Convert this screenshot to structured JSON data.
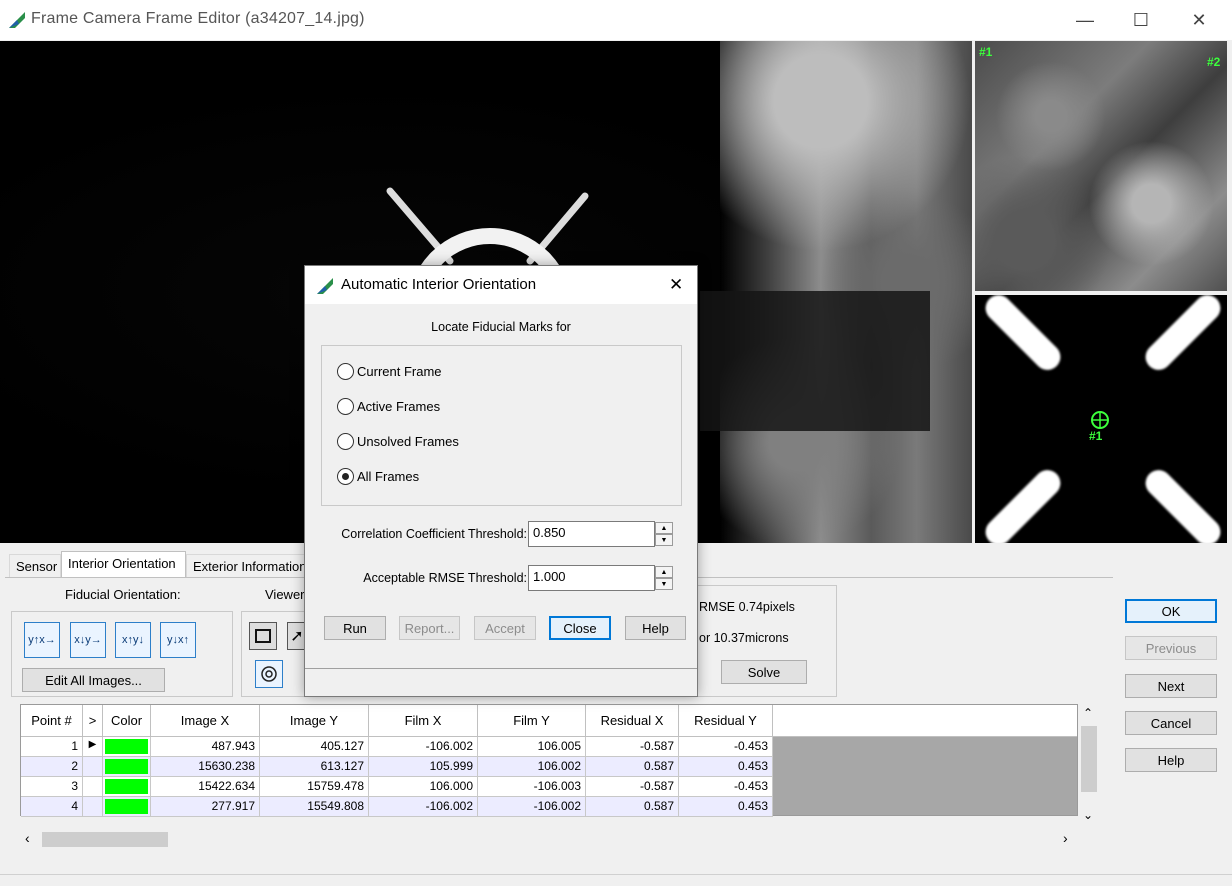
{
  "window": {
    "title": "Frame Camera Frame Editor (a34207_14.jpg)",
    "minimize_glyph": "—",
    "maximize_glyph": "☐",
    "close_glyph": "✕"
  },
  "viewers": {
    "overview_marks": [
      "#1",
      "#2"
    ],
    "zoom_mark": "#1"
  },
  "tabs": [
    "Sensor",
    "Interior Orientation",
    "Exterior Information"
  ],
  "interior": {
    "fiducial_orientation_label": "Fiducial Orientation:",
    "viewer_label": "Viewer",
    "orientation_buttons": [
      "y↑x→",
      "x↓y→",
      "x↑y↓",
      "y↓x↑"
    ],
    "edit_all_label": "Edit All Images...",
    "rmse_text": "RMSE 0.74pixels",
    "microns_text": "or 10.37microns",
    "solve_label": "Solve"
  },
  "table": {
    "columns": [
      "Point #",
      ">",
      "Color",
      "Image X",
      "Image Y",
      "Film X",
      "Film Y",
      "Residual X",
      "Residual Y"
    ],
    "rows": [
      {
        "point": "1",
        "marker": "▶",
        "color": "#00ff00",
        "image_x": "487.943",
        "image_y": "405.127",
        "film_x": "-106.002",
        "film_y": "106.005",
        "res_x": "-0.587",
        "res_y": "-0.453"
      },
      {
        "point": "2",
        "marker": "",
        "color": "#00ff00",
        "image_x": "15630.238",
        "image_y": "613.127",
        "film_x": "105.999",
        "film_y": "106.002",
        "res_x": "0.587",
        "res_y": "0.453"
      },
      {
        "point": "3",
        "marker": "",
        "color": "#00ff00",
        "image_x": "15422.634",
        "image_y": "15759.478",
        "film_x": "106.000",
        "film_y": "-106.003",
        "res_x": "-0.587",
        "res_y": "-0.453"
      },
      {
        "point": "4",
        "marker": "",
        "color": "#00ff00",
        "image_x": "277.917",
        "image_y": "15549.808",
        "film_x": "-106.002",
        "film_y": "-106.002",
        "res_x": "0.587",
        "res_y": "0.453"
      }
    ]
  },
  "side_buttons": {
    "ok": "OK",
    "previous": "Previous",
    "next": "Next",
    "cancel": "Cancel",
    "help": "Help"
  },
  "dialog": {
    "title": "Automatic Interior Orientation",
    "close_glyph": "✕",
    "locate_label": "Locate Fiducial Marks for",
    "options": [
      {
        "label": "Current Frame",
        "selected": false
      },
      {
        "label": "Active Frames",
        "selected": false
      },
      {
        "label": "Unsolved Frames",
        "selected": false
      },
      {
        "label": "All Frames",
        "selected": true
      }
    ],
    "corr_label": "Correlation Coefficient Threshold:",
    "corr_value": "0.850",
    "rmse_label": "Acceptable RMSE Threshold:",
    "rmse_value": "1.000",
    "buttons": {
      "run": "Run",
      "report": "Report...",
      "accept": "Accept",
      "close": "Close",
      "help": "Help"
    }
  },
  "colors": {
    "accent": "#0078d7",
    "point_green": "#00ff00",
    "marker_green": "#3cff3c"
  }
}
